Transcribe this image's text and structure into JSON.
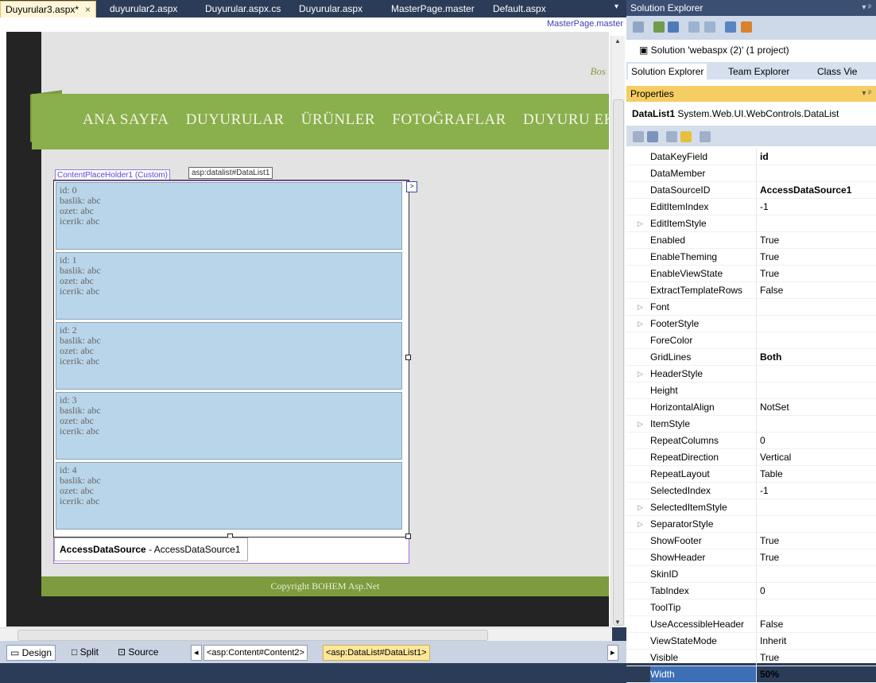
{
  "tabs": [
    {
      "label": "Duyurular3.aspx*",
      "active": true
    },
    {
      "label": "duyurular2.aspx"
    },
    {
      "label": "Duyurular.aspx.cs"
    },
    {
      "label": "Duyurular.aspx"
    },
    {
      "label": "MasterPage.master"
    },
    {
      "label": "Default.aspx"
    }
  ],
  "tab_close": "×",
  "tab_dropdown": "▾",
  "editor": {
    "master_label": "MasterPage.master",
    "bos_text": "Bos",
    "nav_items": [
      "ANA SAYFA",
      "DUYURULAR",
      "ÜRÜNLER",
      "FOTOĞRAFLAR",
      "DUYURU EKL"
    ],
    "cph_tag": "ContentPlaceHolder1 (Custom)",
    "datalist_tag": "asp:datalist#DataList1",
    "smart_tag": ">",
    "items": [
      {
        "id": "id: 0",
        "baslik": "baslik: abc",
        "ozet": "ozet: abc",
        "icerik": "icerik: abc"
      },
      {
        "id": "id: 1",
        "baslik": "baslik: abc",
        "ozet": "ozet: abc",
        "icerik": "icerik: abc"
      },
      {
        "id": "id: 2",
        "baslik": "baslik: abc",
        "ozet": "ozet: abc",
        "icerik": "icerik: abc"
      },
      {
        "id": "id: 3",
        "baslik": "baslik: abc",
        "ozet": "ozet: abc",
        "icerik": "icerik: abc"
      },
      {
        "id": "id: 4",
        "baslik": "baslik: abc",
        "ozet": "ozet: abc",
        "icerik": "icerik: abc"
      }
    ],
    "ads_bold": "AccessDataSource",
    "ads_rest": " - AccessDataSource1",
    "footer": "Copyright BOHEM Asp.Net"
  },
  "bottombar": {
    "design": "Design",
    "split": "Split",
    "source": "Source",
    "crumb1": "<asp:Content#Content2>",
    "crumb2": "<asp:DataList#DataList1>"
  },
  "solution_explorer": {
    "title": "Solution Explorer",
    "pin": "▾ ᵖ",
    "item": "Solution 'webaspx (2)' (1 project)",
    "tabs": [
      "Solution Explorer",
      "Team Explorer",
      "Class Vie"
    ]
  },
  "properties": {
    "title": "Properties",
    "object_name": "DataList1",
    "object_type": "System.Web.UI.WebControls.DataList",
    "rows": [
      {
        "name": "DataKeyField",
        "value": "id",
        "bold": true
      },
      {
        "name": "DataMember",
        "value": ""
      },
      {
        "name": "DataSourceID",
        "value": "AccessDataSource1",
        "bold": true
      },
      {
        "name": "EditItemIndex",
        "value": "-1"
      },
      {
        "name": "EditItemStyle",
        "value": "",
        "expand": true
      },
      {
        "name": "Enabled",
        "value": "True"
      },
      {
        "name": "EnableTheming",
        "value": "True"
      },
      {
        "name": "EnableViewState",
        "value": "True"
      },
      {
        "name": "ExtractTemplateRows",
        "value": "False"
      },
      {
        "name": "Font",
        "value": "",
        "expand": true
      },
      {
        "name": "FooterStyle",
        "value": "",
        "expand": true
      },
      {
        "name": "ForeColor",
        "value": ""
      },
      {
        "name": "GridLines",
        "value": "Both",
        "bold": true
      },
      {
        "name": "HeaderStyle",
        "value": "",
        "expand": true
      },
      {
        "name": "Height",
        "value": ""
      },
      {
        "name": "HorizontalAlign",
        "value": "NotSet"
      },
      {
        "name": "ItemStyle",
        "value": "",
        "expand": true
      },
      {
        "name": "RepeatColumns",
        "value": "0"
      },
      {
        "name": "RepeatDirection",
        "value": "Vertical"
      },
      {
        "name": "RepeatLayout",
        "value": "Table"
      },
      {
        "name": "SelectedIndex",
        "value": "-1"
      },
      {
        "name": "SelectedItemStyle",
        "value": "",
        "expand": true
      },
      {
        "name": "SeparatorStyle",
        "value": "",
        "expand": true
      },
      {
        "name": "ShowFooter",
        "value": "True"
      },
      {
        "name": "ShowHeader",
        "value": "True"
      },
      {
        "name": "SkinID",
        "value": ""
      },
      {
        "name": "TabIndex",
        "value": "0"
      },
      {
        "name": "ToolTip",
        "value": ""
      },
      {
        "name": "UseAccessibleHeader",
        "value": "False"
      },
      {
        "name": "ViewStateMode",
        "value": "Inherit"
      },
      {
        "name": "Visible",
        "value": "True"
      },
      {
        "name": "Width",
        "value": "50%",
        "bold": true,
        "selected": true
      }
    ]
  }
}
